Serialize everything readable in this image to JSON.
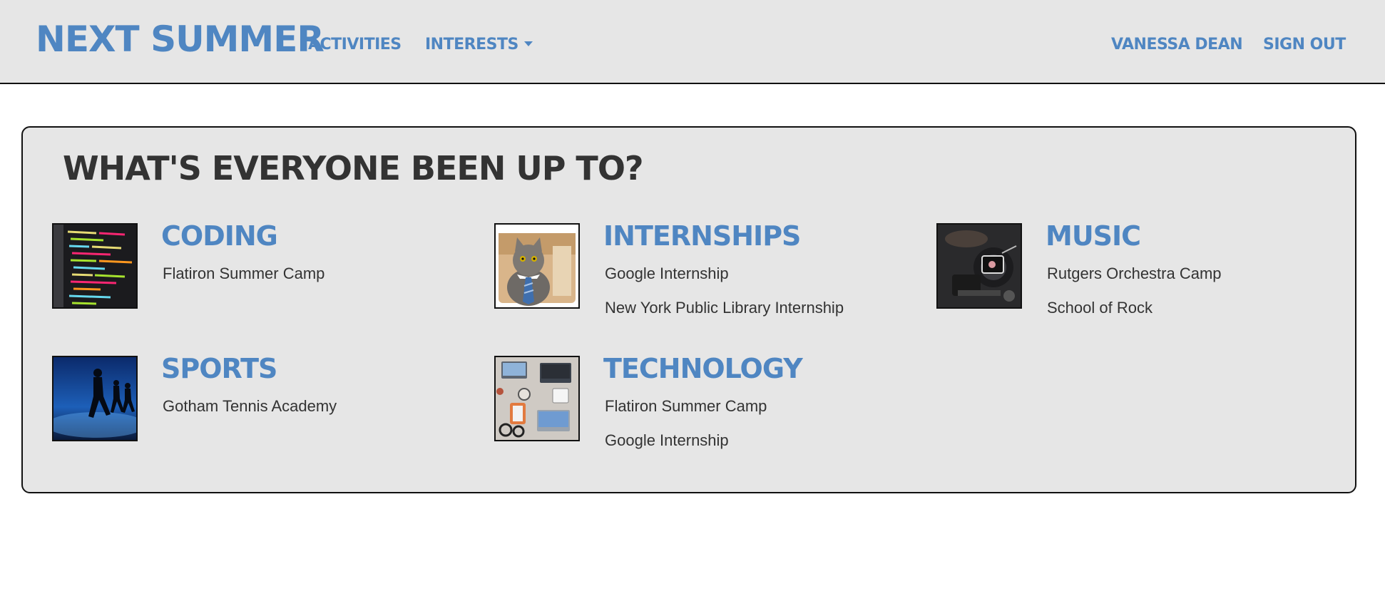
{
  "nav": {
    "brand": "NEXT SUMMER",
    "activities": "ACTIVITIES",
    "interests": "INTERESTS",
    "user": "VANESSA DEAN",
    "signout": "SIGN OUT"
  },
  "main": {
    "title": "WHAT'S EVERYONE BEEN UP TO?",
    "categories": [
      {
        "title": "CODING",
        "image": "code-screen-image",
        "items": [
          "Flatiron Summer Camp"
        ]
      },
      {
        "title": "INTERNSHIPS",
        "image": "cat-in-tie-image",
        "items": [
          "Google Internship",
          "New York Public Library Internship"
        ]
      },
      {
        "title": "MUSIC",
        "image": "camera-gear-image",
        "items": [
          "Rutgers Orchestra Camp",
          "School of Rock"
        ]
      },
      {
        "title": "SPORTS",
        "image": "runners-image",
        "items": [
          "Gotham Tennis Academy"
        ]
      },
      {
        "title": "TECHNOLOGY",
        "image": "desk-laptops-image",
        "items": [
          "Flatiron Summer Camp",
          "Google Internship"
        ]
      }
    ]
  },
  "colors": {
    "accent": "#4f86c2",
    "text": "#333333",
    "panel": "#e6e6e6"
  }
}
